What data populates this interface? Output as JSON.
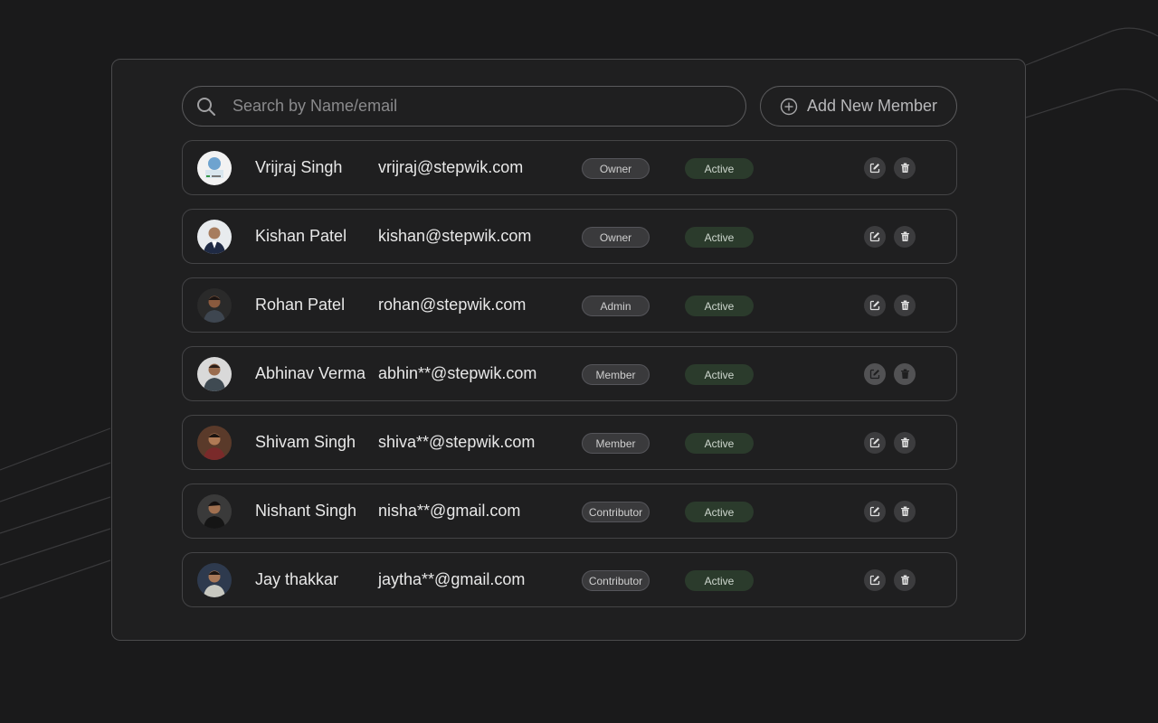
{
  "search": {
    "placeholder": "Search by Name/email",
    "icon": "search-icon"
  },
  "add_button": {
    "label": "Add New Member",
    "icon": "plus-circle-icon"
  },
  "members": [
    {
      "name": "Vrijraj Singh",
      "email": "vrijraj@stepwik.com",
      "role": "Owner",
      "status": "Active"
    },
    {
      "name": "Kishan Patel",
      "email": "kishan@stepwik.com",
      "role": "Owner",
      "status": "Active"
    },
    {
      "name": "Rohan Patel",
      "email": "rohan@stepwik.com",
      "role": "Admin",
      "status": "Active"
    },
    {
      "name": "Abhinav Verma",
      "email": "abhin**@stepwik.com",
      "role": "Member",
      "status": "Active"
    },
    {
      "name": "Shivam Singh",
      "email": "shiva**@stepwik.com",
      "role": "Member",
      "status": "Active"
    },
    {
      "name": "Nishant Singh",
      "email": "nisha**@gmail.com",
      "role": "Contributor",
      "status": "Active"
    },
    {
      "name": "Jay thakkar",
      "email": "jaytha**@gmail.com",
      "role": "Contributor",
      "status": "Active"
    }
  ],
  "colors": {
    "background": "#1a1a1b",
    "status_active_bg": "#2b3b2c",
    "role_bg": "#3a3a3c"
  }
}
